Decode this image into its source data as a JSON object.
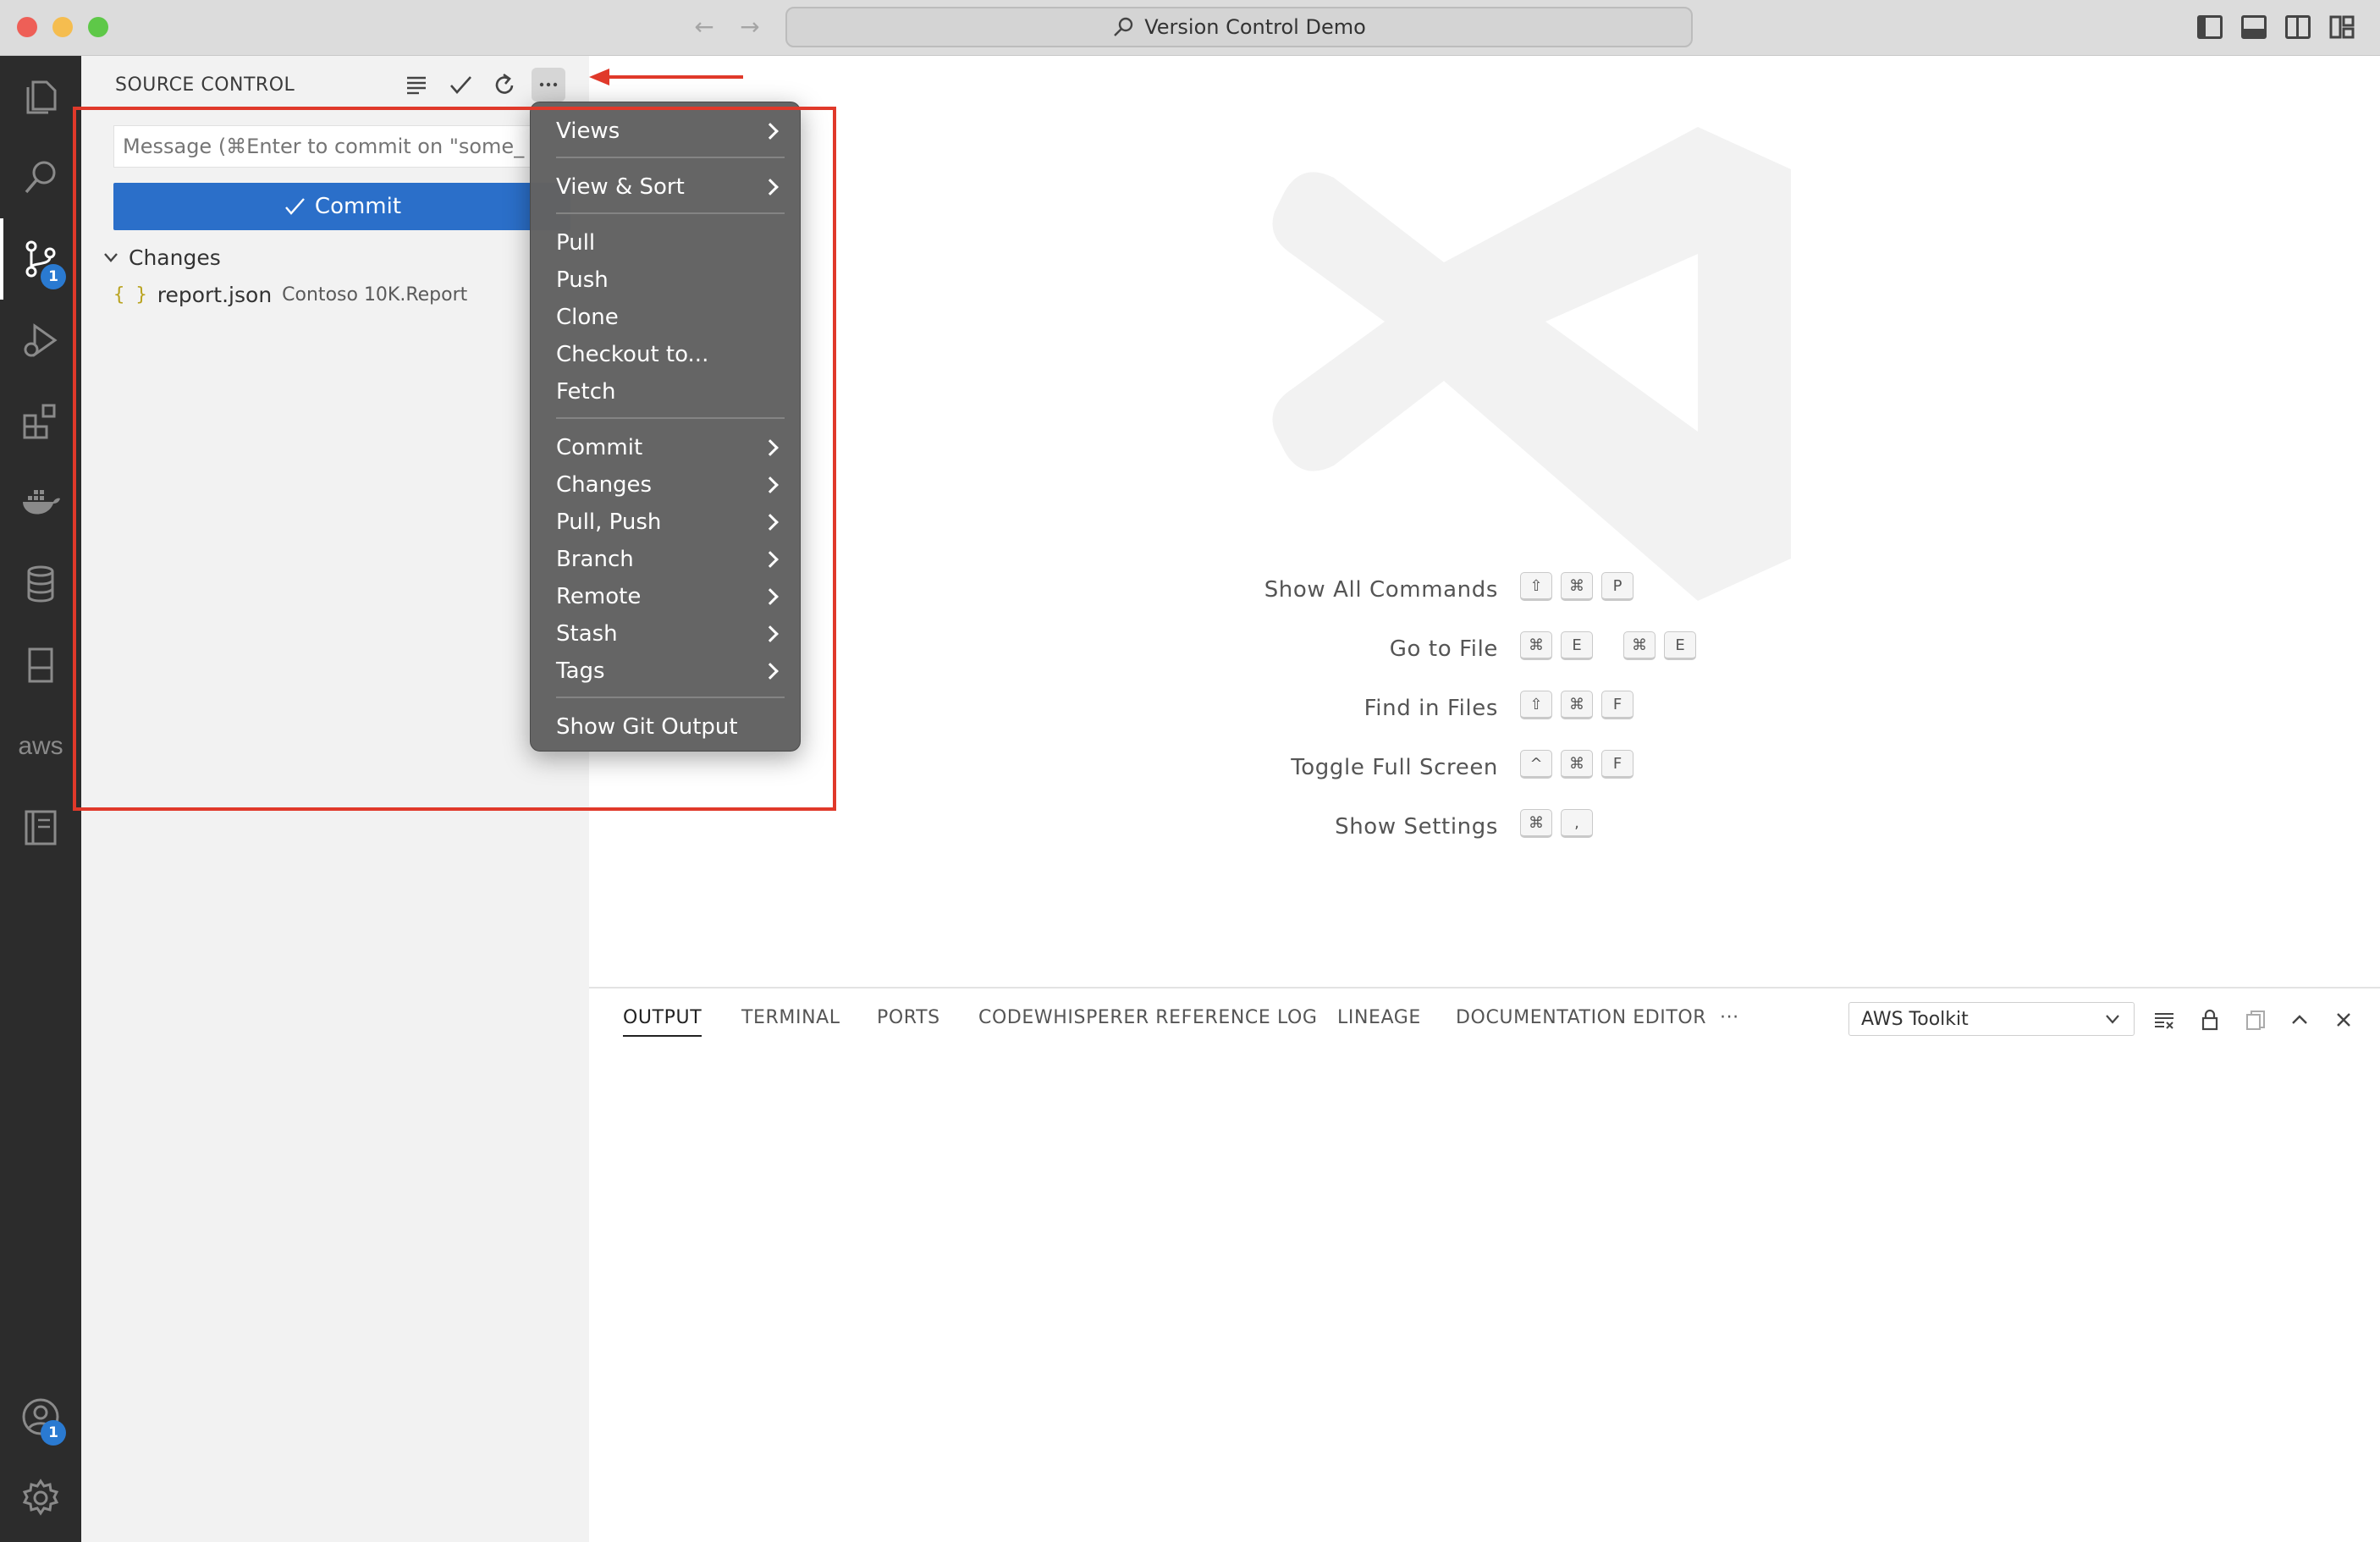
{
  "window": {
    "title": "Version Control Demo"
  },
  "activity_bar": {
    "scm_badge": "1",
    "aws_label": "aws",
    "accounts_badge": "1"
  },
  "sidebar": {
    "title": "SOURCE CONTROL",
    "message_placeholder": "Message (⌘Enter to commit on \"some_",
    "commit_label": "Commit",
    "changes_label": "Changes",
    "file": {
      "name": "report.json",
      "path": "Contoso 10K.Report",
      "icon_glyph": "{ }"
    }
  },
  "menu": {
    "items": [
      {
        "label": "Views",
        "submenu": true
      },
      {
        "label": "View & Sort",
        "submenu": true
      },
      {
        "label": "Pull",
        "submenu": false
      },
      {
        "label": "Push",
        "submenu": false
      },
      {
        "label": "Clone",
        "submenu": false
      },
      {
        "label": "Checkout to...",
        "submenu": false
      },
      {
        "label": "Fetch",
        "submenu": false
      },
      {
        "label": "Commit",
        "submenu": true
      },
      {
        "label": "Changes",
        "submenu": true
      },
      {
        "label": "Pull, Push",
        "submenu": true
      },
      {
        "label": "Branch",
        "submenu": true
      },
      {
        "label": "Remote",
        "submenu": true
      },
      {
        "label": "Stash",
        "submenu": true
      },
      {
        "label": "Tags",
        "submenu": true
      },
      {
        "label": "Show Git Output",
        "submenu": false
      }
    ]
  },
  "welcome": {
    "shortcuts": [
      {
        "label": "Show All Commands",
        "keys": [
          "⇧",
          "⌘",
          "P"
        ]
      },
      {
        "label": "Go to File",
        "keys": [
          "⌘",
          "E",
          "|",
          "⌘",
          "E"
        ]
      },
      {
        "label": "Find in Files",
        "keys": [
          "⇧",
          "⌘",
          "F"
        ]
      },
      {
        "label": "Toggle Full Screen",
        "keys": [
          "^",
          "⌘",
          "F"
        ]
      },
      {
        "label": "Show Settings",
        "keys": [
          "⌘",
          ","
        ]
      }
    ]
  },
  "panel": {
    "tabs": [
      "OUTPUT",
      "TERMINAL",
      "PORTS",
      "CODEWHISPERER REFERENCE LOG",
      "LINEAGE",
      "DOCUMENTATION EDITOR"
    ],
    "more": "···",
    "output_channel": "AWS Toolkit"
  },
  "colors": {
    "accent": "#2b6fc9",
    "annotation": "#e0392a",
    "menu_bg": "#626262",
    "activity_bar": "#2c2c2c"
  }
}
